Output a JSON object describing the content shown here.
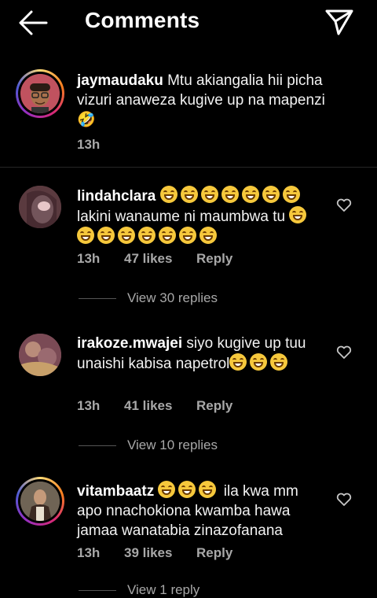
{
  "header": {
    "title": "Comments"
  },
  "caption": {
    "username": "jaymaudaku",
    "text": "Mtu akiangalia hii picha vizuri anaweza kugive up na mapenzi 🤣",
    "time": "13h"
  },
  "comments": [
    {
      "username": "lindahclara",
      "text": "lakini wanaume ni maumbwa tu",
      "time": "13h",
      "likes": "47 likes",
      "reply": "Reply",
      "view_replies": "View 30 replies"
    },
    {
      "username": "irakoze.mwajei",
      "text": "siyo kugive up tuu unaishi kabisa napetrol",
      "time": "13h",
      "likes": "41 likes",
      "reply": "Reply",
      "view_replies": "View 10 replies"
    },
    {
      "username": "vitambaatz",
      "text": "ila kwa mm apo nnachokiona kwamba hawa jamaa wanatabia zinazofanana",
      "time": "13h",
      "likes": "39 likes",
      "reply": "Reply",
      "view_replies": "View 1 reply"
    }
  ],
  "icons": {
    "back": "arrow-left-icon",
    "send": "paper-plane-icon",
    "like": "heart-outline-icon",
    "emoji": "grinning-face-emoji"
  },
  "colors": {
    "background": "#000000",
    "text": "#ffffff",
    "secondary": "#a8a8a8",
    "story_ring": "#d62976"
  }
}
